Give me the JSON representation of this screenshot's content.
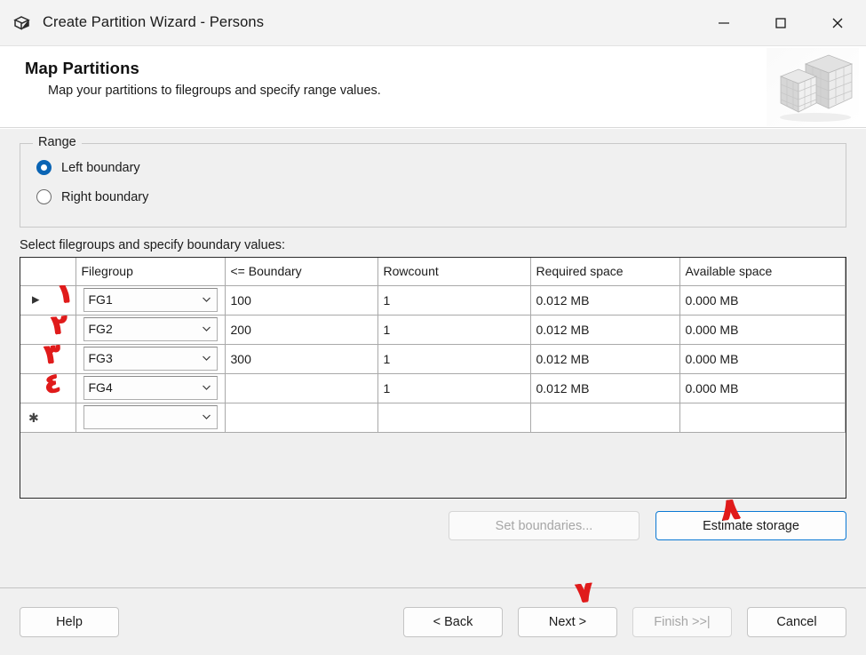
{
  "window": {
    "title": "Create Partition Wizard - Persons",
    "icon": "cube-box-icon",
    "minimize_label": "—",
    "maximize_label": "□",
    "close_label": "✕"
  },
  "header": {
    "title": "Map Partitions",
    "subtitle": "Map your partitions to filegroups and specify range values.",
    "art": "partition-blocks-graphic"
  },
  "range_group": {
    "legend": "Range",
    "options": [
      {
        "label": "Left boundary",
        "selected": true
      },
      {
        "label": "Right boundary",
        "selected": false
      }
    ]
  },
  "grid": {
    "caption": "Select filegroups and specify boundary values:",
    "columns": [
      "",
      "Filegroup",
      "<= Boundary",
      "Rowcount",
      "Required space",
      "Available space"
    ],
    "rows": [
      {
        "indicator": "▶",
        "filegroup": "FG1",
        "boundary": "100",
        "rowcount": "1",
        "required_space": "0.012 MB",
        "available_space": "0.000 MB",
        "rowcount_selected": true
      },
      {
        "indicator": "",
        "filegroup": "FG2",
        "boundary": "200",
        "rowcount": "1",
        "required_space": "0.012 MB",
        "available_space": "0.000 MB",
        "rowcount_selected": false
      },
      {
        "indicator": "",
        "filegroup": "FG3",
        "boundary": "300",
        "rowcount": "1",
        "required_space": "0.012 MB",
        "available_space": "0.000 MB",
        "rowcount_selected": false
      },
      {
        "indicator": "",
        "filegroup": "FG4",
        "boundary": "",
        "rowcount": "1",
        "required_space": "0.012 MB",
        "available_space": "0.000 MB",
        "rowcount_selected": false
      },
      {
        "indicator": "✱",
        "filegroup": "",
        "boundary": "",
        "rowcount": "",
        "required_space": "",
        "available_space": "",
        "rowcount_selected": false
      }
    ]
  },
  "mid_buttons": {
    "set_boundaries": "Set boundaries...",
    "estimate_storage": "Estimate storage"
  },
  "footer": {
    "help": "Help",
    "back": "< Back",
    "next": "Next >",
    "finish": "Finish >>|",
    "cancel": "Cancel"
  },
  "annotations": {
    "color": "#e01b1b",
    "marks": [
      {
        "text": "١",
        "target": "row-1"
      },
      {
        "text": "٢",
        "target": "row-2"
      },
      {
        "text": "٣",
        "target": "row-3"
      },
      {
        "text": "٤",
        "target": "row-4"
      },
      {
        "text": "٨",
        "target": "estimate-storage-button"
      },
      {
        "text": "٧",
        "target": "next-button"
      }
    ]
  }
}
